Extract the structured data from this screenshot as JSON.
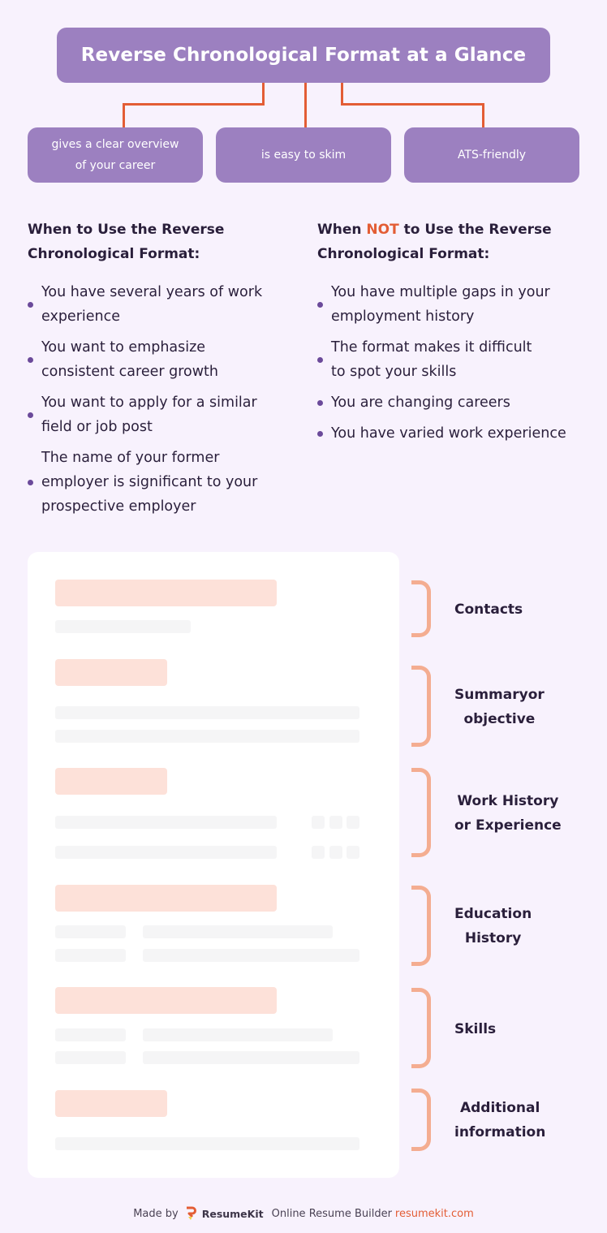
{
  "title": "Reverse Chronological Format at a Glance",
  "benefits": [
    {
      "line1": "gives a clear overview",
      "line2": "of your career"
    },
    {
      "line1": "is easy to skim",
      "line2": ""
    },
    {
      "line1": "ATS-friendly",
      "line2": ""
    }
  ],
  "when_to_use": {
    "heading_line1": "When to Use the Reverse",
    "heading_line2": "Chronological Format:",
    "items": [
      {
        "line1": "You have several years of work",
        "line2": "experience",
        "line3": ""
      },
      {
        "line1": "You want to emphasize",
        "line2": "consistent career growth",
        "line3": ""
      },
      {
        "line1": "You want to apply for a similar",
        "line2": "field or job post",
        "line3": ""
      },
      {
        "line1": "The name of your former",
        "line2": "employer is significant to your",
        "line3": "prospective employer"
      }
    ]
  },
  "when_not_to_use": {
    "heading_prefix": "When ",
    "heading_highlight": "NOT",
    "heading_suffix": " to Use the Reverse",
    "heading_line2": "Chronological Format:",
    "items": [
      {
        "line1": "You have multiple gaps in your",
        "line2": "employment history"
      },
      {
        "line1": "The format makes it difficult",
        "line2": "to spot your skills"
      },
      {
        "line1": "You are changing careers",
        "line2": ""
      },
      {
        "line1": "You have varied work experience",
        "line2": ""
      }
    ]
  },
  "resume_sections": [
    {
      "line1": "Contacts",
      "line2": ""
    },
    {
      "line1": "Summaryor",
      "line2": "objective"
    },
    {
      "line1": "Work History",
      "line2": "or Experience"
    },
    {
      "line1": "Education",
      "line2": "History"
    },
    {
      "line1": "Skills",
      "line2": ""
    },
    {
      "line1": "Additional",
      "line2": "information"
    }
  ],
  "footer": {
    "made_by": "Made by",
    "brand": "ResumeKit",
    "tagline": "Online Resume Builder",
    "site": "resumekit.com"
  },
  "colors": {
    "accent_purple": "#9c80c0",
    "accent_orange": "#e35d35",
    "bracket_peach": "#f4ad91",
    "placeholder_pink": "#fde1d9",
    "background": "#f8f2fd"
  }
}
